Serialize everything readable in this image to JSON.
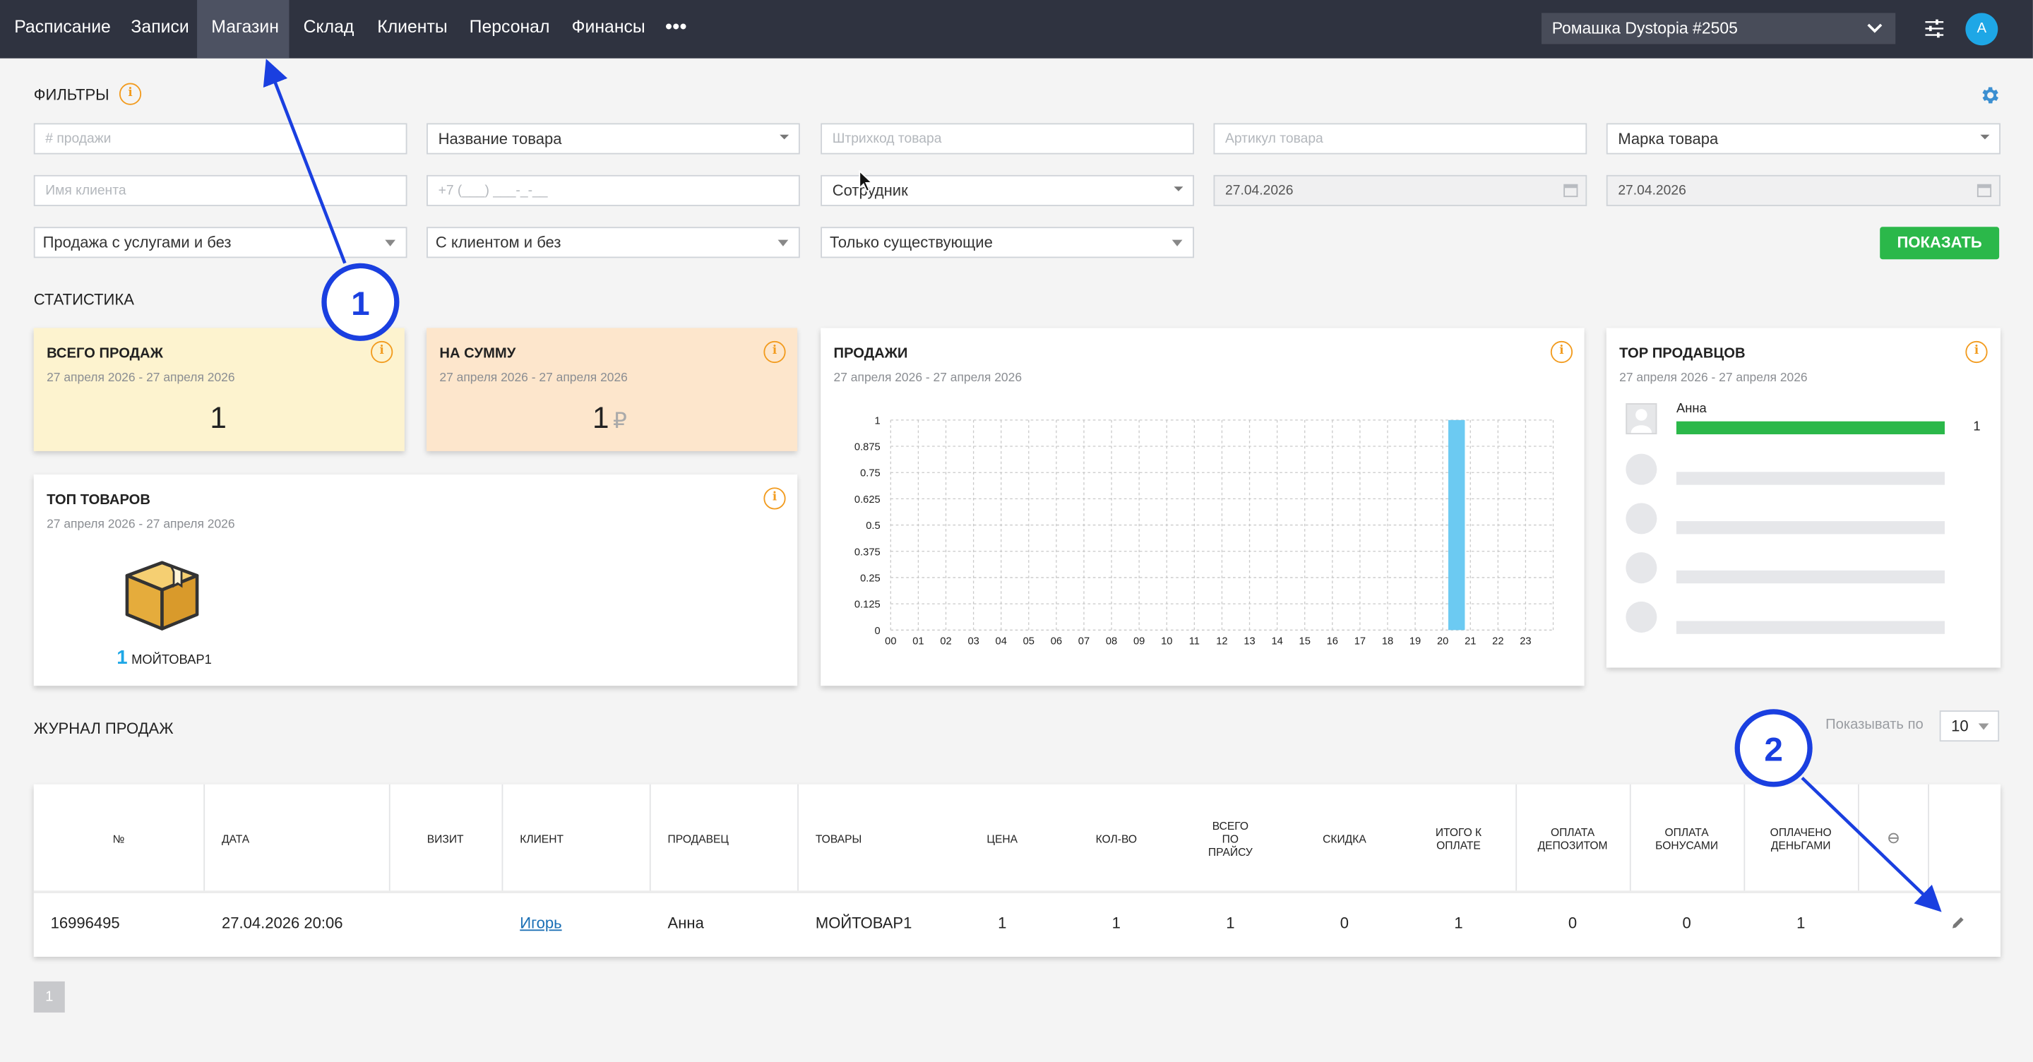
{
  "nav": {
    "items": [
      "Расписание",
      "Записи",
      "Магазин",
      "Склад",
      "Клиенты",
      "Персонал",
      "Финансы"
    ],
    "active": "Магазин",
    "more": "•••",
    "salon": "Ромашка Dystopia #2505",
    "avatar": "A"
  },
  "filters": {
    "title": "ФИЛЬТРЫ",
    "sale_no_placeholder": "# продажи",
    "product_name": "Название товара",
    "barcode_placeholder": "Штрихкод товара",
    "article_placeholder": "Артикул товара",
    "brand": "Марка товара",
    "client_name_placeholder": "Имя клиента",
    "phone_placeholder": "+7 (___) ___-_-__",
    "employee": "Сотрудник",
    "date_from": "27.04.2026",
    "date_to": "27.04.2026",
    "services": "Продажа с услугами и без",
    "with_client": "С клиентом и без",
    "existing": "Только существующие",
    "show_button": "ПОКАЗАТЬ"
  },
  "stats": {
    "title": "СТАТИСТИКА",
    "total_sales": {
      "title": "ВСЕГО ПРОДАЖ",
      "period": "27 апреля 2026 - 27 апреля 2026",
      "value": "1"
    },
    "sum": {
      "title": "НА СУММУ",
      "period": "27 апреля 2026 - 27 апреля 2026",
      "value": "1",
      "currency": "₽"
    },
    "top_products": {
      "title": "ТОП ТОВАРОВ",
      "period": "27 апреля 2026 - 27 апреля 2026",
      "count": "1",
      "name": "МОЙТОВАР1"
    },
    "sales_chart": {
      "title": "ПРОДАЖИ",
      "period": "27 апреля 2026 - 27 апреля 2026"
    },
    "top_sellers": {
      "title": "ТОР ПРОДАВЦОВ",
      "period": "27 апреля 2026 - 27 апреля 2026",
      "seller": "Анна",
      "count": "1"
    }
  },
  "chart_data": {
    "type": "bar",
    "categories": [
      "00",
      "01",
      "02",
      "03",
      "04",
      "05",
      "06",
      "07",
      "08",
      "09",
      "10",
      "11",
      "12",
      "13",
      "14",
      "15",
      "16",
      "17",
      "18",
      "19",
      "20",
      "21",
      "22",
      "23"
    ],
    "values": [
      0,
      0,
      0,
      0,
      0,
      0,
      0,
      0,
      0,
      0,
      0,
      0,
      0,
      0,
      0,
      0,
      0,
      0,
      0,
      0,
      1,
      0,
      0,
      0
    ],
    "y_ticks": [
      "0",
      "0.125",
      "0.25",
      "0.375",
      "0.5",
      "0.625",
      "0.75",
      "0.875",
      "1"
    ],
    "ylim": [
      0,
      1
    ],
    "bar_color": "#6ccaf2",
    "grid": true
  },
  "journal": {
    "title": "ЖУРНАЛ ПРОДАЖ",
    "per_page_label": "Показывать по",
    "per_page": "10",
    "headers": [
      "№",
      "ДАТА",
      "ВИЗИТ",
      "КЛИЕНТ",
      "ПРОДАВЕЦ",
      "ТОВАРЫ",
      "ЦЕНА",
      "КОЛ-ВО",
      "ВСЕГО ПО ПРАЙСУ",
      "СКИДКА",
      "ИТОГО К ОПЛАТЕ",
      "ОПЛАТА ДЕПОЗИТОМ",
      "ОПЛАТА БОНУСАМИ",
      "ОПЛАЧЕНО ДЕНЬГАМИ"
    ],
    "header_lines": {
      "total_by_price": [
        "ВСЕГО",
        "ПО",
        "ПРАЙСУ"
      ],
      "total_to_pay": [
        "ИТОГО К",
        "ОПЛАТЕ"
      ],
      "pay_deposit": [
        "ОПЛАТА",
        "ДЕПОЗИТОМ"
      ],
      "pay_bonus": [
        "ОПЛАТА",
        "БОНУСАМИ"
      ],
      "paid_money": [
        "ОПЛАЧЕНО",
        "ДЕНЬГАМИ"
      ]
    },
    "row": {
      "number": "16996495",
      "date": "27.04.2026 20:06",
      "visit": "",
      "client": "Игорь",
      "seller": "Анна",
      "product": "МОЙТОВАР1",
      "price": "1",
      "qty": "1",
      "total_by_price": "1",
      "discount": "0",
      "total_to_pay": "1",
      "pay_deposit": "0",
      "pay_bonus": "0",
      "paid_money": "1"
    },
    "page": "1"
  },
  "annotations": {
    "one": "1",
    "two": "2",
    "color": "#1a3fe0"
  },
  "colors": {
    "nav_bg": "#2f3340",
    "accent_orange": "#f29b1e",
    "green": "#2bb84a",
    "card_yellow": "#fdf3cf",
    "card_peach": "#fde6cc"
  }
}
